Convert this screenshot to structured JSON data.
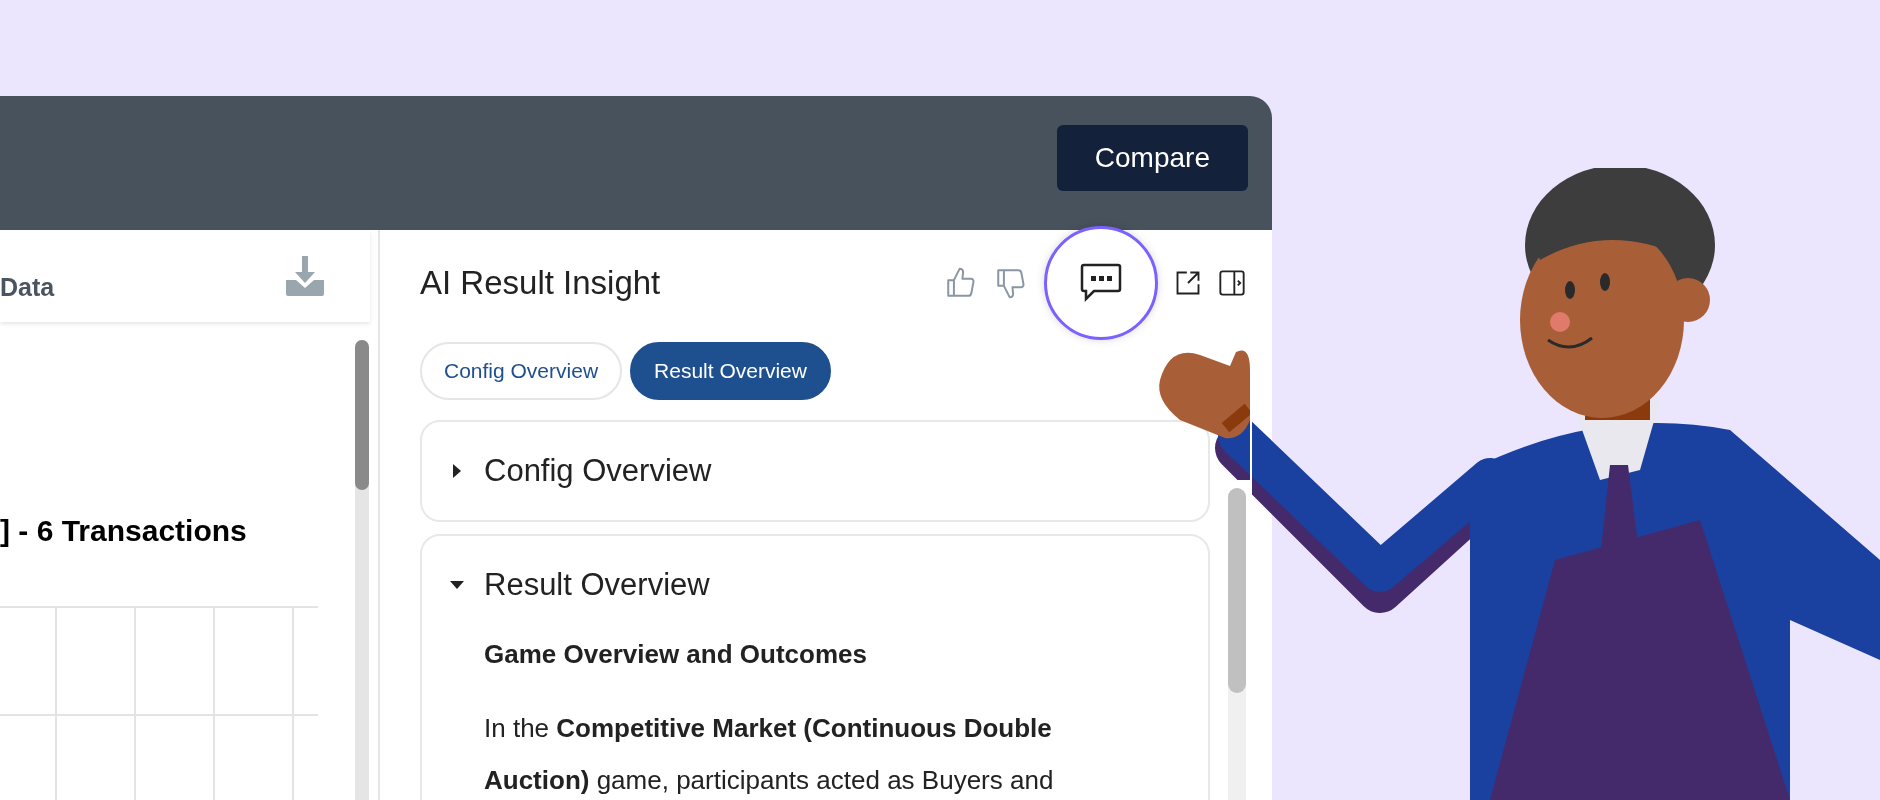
{
  "header": {
    "compare_button": "Compare"
  },
  "data_panel": {
    "title": "Data",
    "heading": "] - 6 Transactions"
  },
  "insight_panel": {
    "title": "AI Result Insight",
    "tabs": [
      {
        "label": "Config Overview",
        "selected": false
      },
      {
        "label": "Result Overview",
        "selected": true
      }
    ],
    "sections": [
      {
        "title": "Config Overview",
        "expanded": false
      },
      {
        "title": "Result Overview",
        "expanded": true,
        "heading": "Game Overview and Outcomes",
        "paragraph": "In the **Competitive Market (Continuous Double Auction)** game, participants acted as Buyers and"
      }
    ]
  }
}
